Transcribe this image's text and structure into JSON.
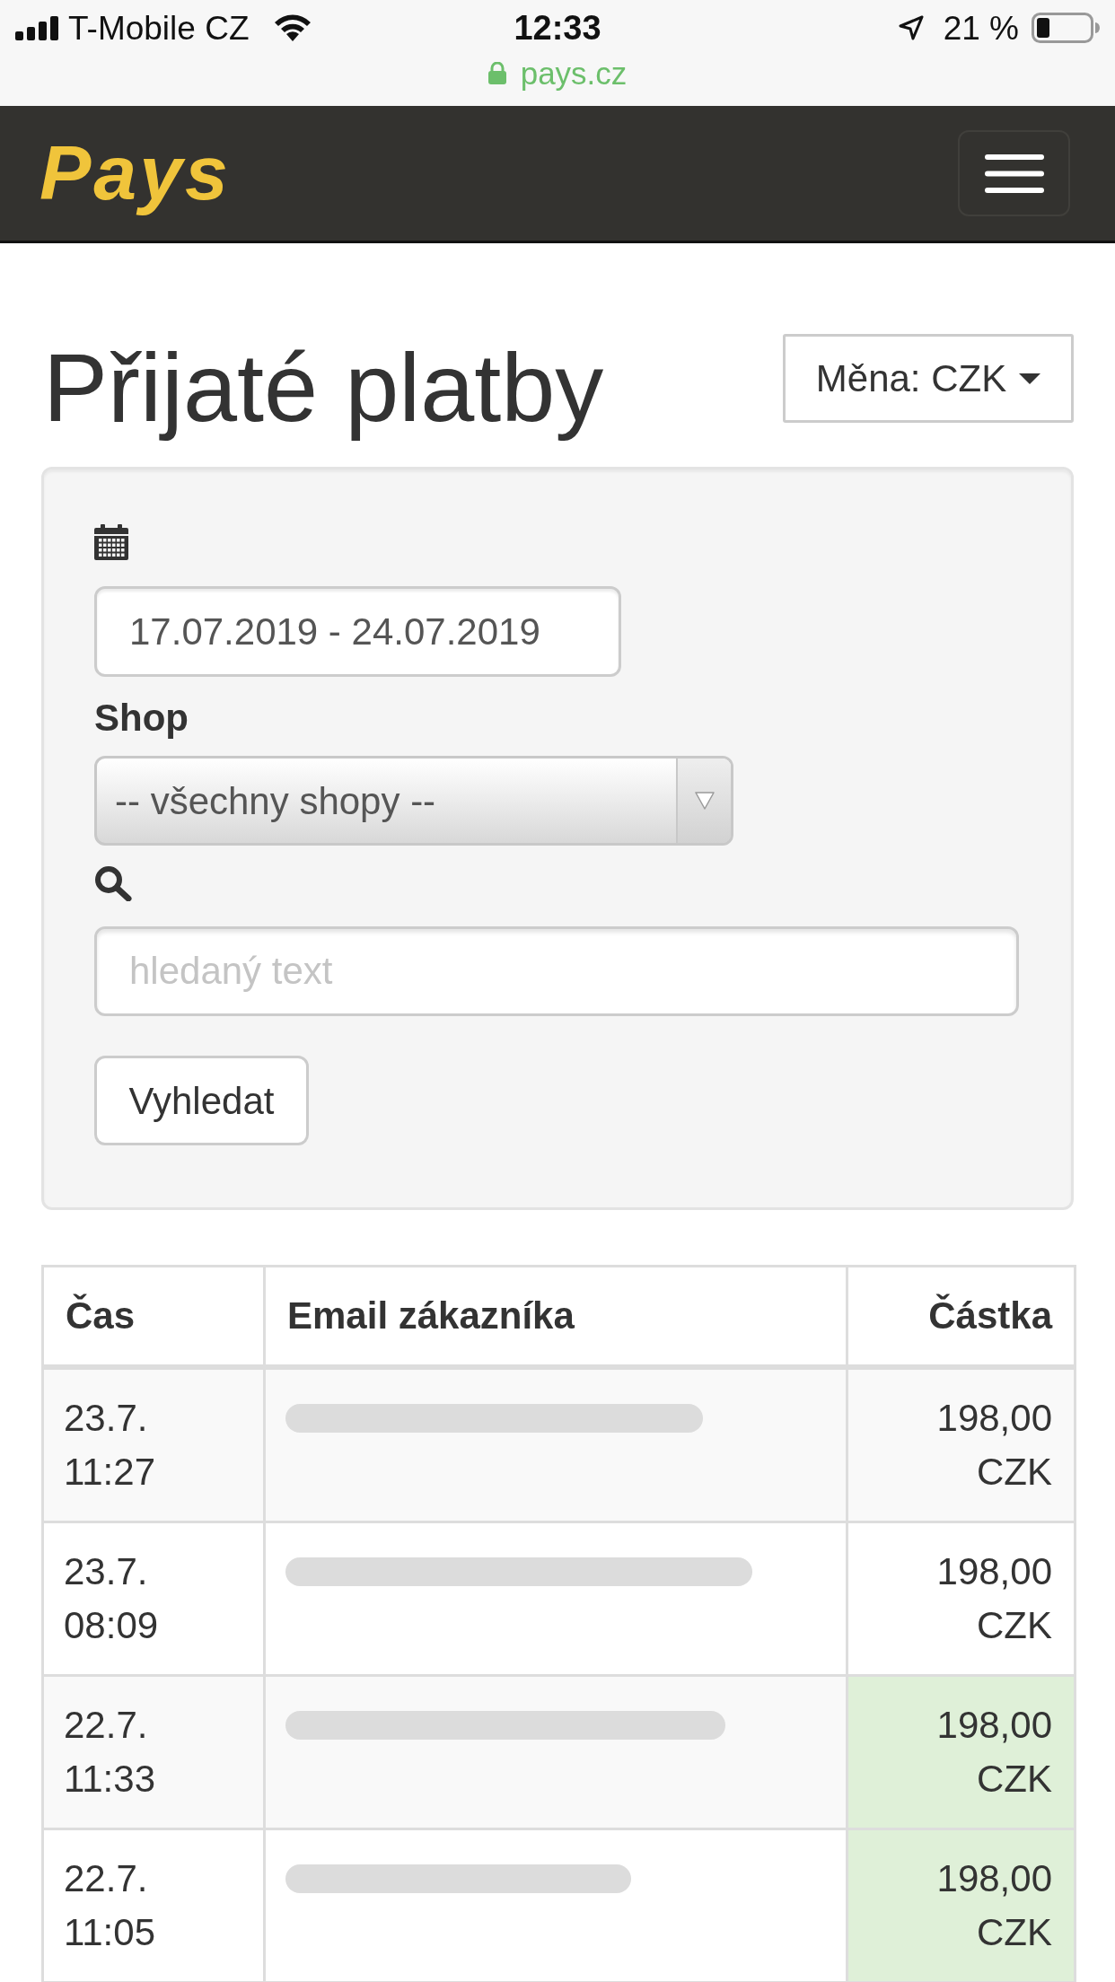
{
  "status_bar": {
    "carrier": "T-Mobile CZ",
    "time": "12:33",
    "battery": "21 %",
    "url": "pays.cz"
  },
  "navbar": {
    "logo": "Pays"
  },
  "header": {
    "title": "Přijaté platby",
    "currency_button": "Měna: CZK"
  },
  "filter": {
    "date_range": "17.07.2019 - 24.07.2019",
    "shop_label": "Shop",
    "shop_select": "-- všechny shopy --",
    "search_placeholder": "hledaný text",
    "search_button": "Vyhledat"
  },
  "table": {
    "columns": [
      "Čas",
      "Email zákazníka",
      "Částka"
    ],
    "rows": [
      {
        "time": "23.7. 11:27",
        "email_blurred": true,
        "amount": "198,00 CZK",
        "amount_highlighted": false
      },
      {
        "time": "23.7. 08:09",
        "email_blurred": true,
        "amount": "198,00 CZK",
        "amount_highlighted": false
      },
      {
        "time": "22.7. 11:33",
        "email_blurred": true,
        "amount": "198,00 CZK",
        "amount_highlighted": true
      },
      {
        "time": "22.7. 11:05",
        "email_blurred": true,
        "amount": "198,00 CZK",
        "amount_highlighted": true
      }
    ]
  }
}
